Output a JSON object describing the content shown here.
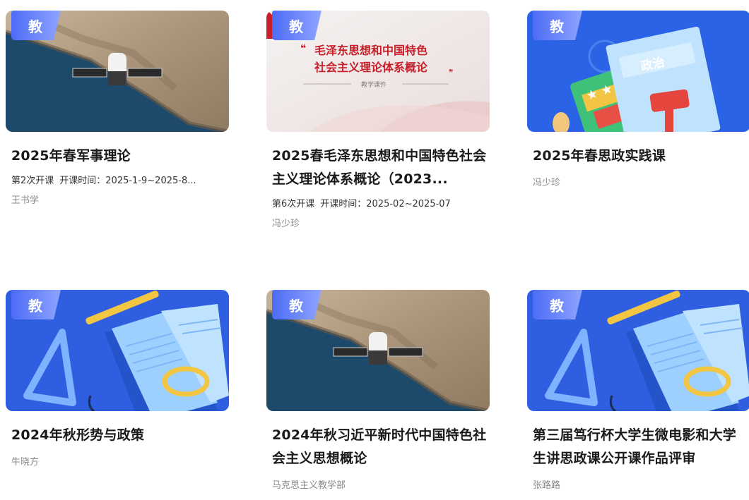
{
  "courses": [
    {
      "badge": "教",
      "title": "2025年春军事理论",
      "session": "第2次开课",
      "time": "开课时间：2025-1-9~2025-8...",
      "teacher": "王书学",
      "cover": "satellite-coast"
    },
    {
      "badge": "教",
      "title": "2025春毛泽东思想和中国特色社会主义理论体系概论（2023...",
      "session": "第6次开课",
      "time": "开课时间：2025-02~2025-07",
      "teacher": "冯少珍",
      "cover": "red-title",
      "cover_text": [
        "毛泽东思想和中国特色",
        "社会主义理论体系概论",
        "教学课件"
      ]
    },
    {
      "badge": "教",
      "title": "2025年春思政实践课",
      "teacher": "冯少珍",
      "cover": "politics-book",
      "cover_text": [
        "政治"
      ]
    },
    {
      "badge": "教",
      "title": "2024年秋形势与政策",
      "teacher": "牛晓方",
      "cover": "blue-book"
    },
    {
      "badge": "教",
      "title": "2024年秋习近平新时代中国特色社会主义思想概论",
      "teacher": "马克思主义教学部",
      "cover": "satellite-coast"
    },
    {
      "badge": "教",
      "title": "第三届笃行杯大学生微电影和大学生讲思政课公开课作品评审",
      "teacher": "张路路",
      "cover": "blue-book"
    }
  ],
  "colors": {
    "badge_start": "#4d6cf5",
    "badge_end": "#8ea4ff",
    "red_title": "#c8202a",
    "blue_bg": "#2f5fe0"
  }
}
